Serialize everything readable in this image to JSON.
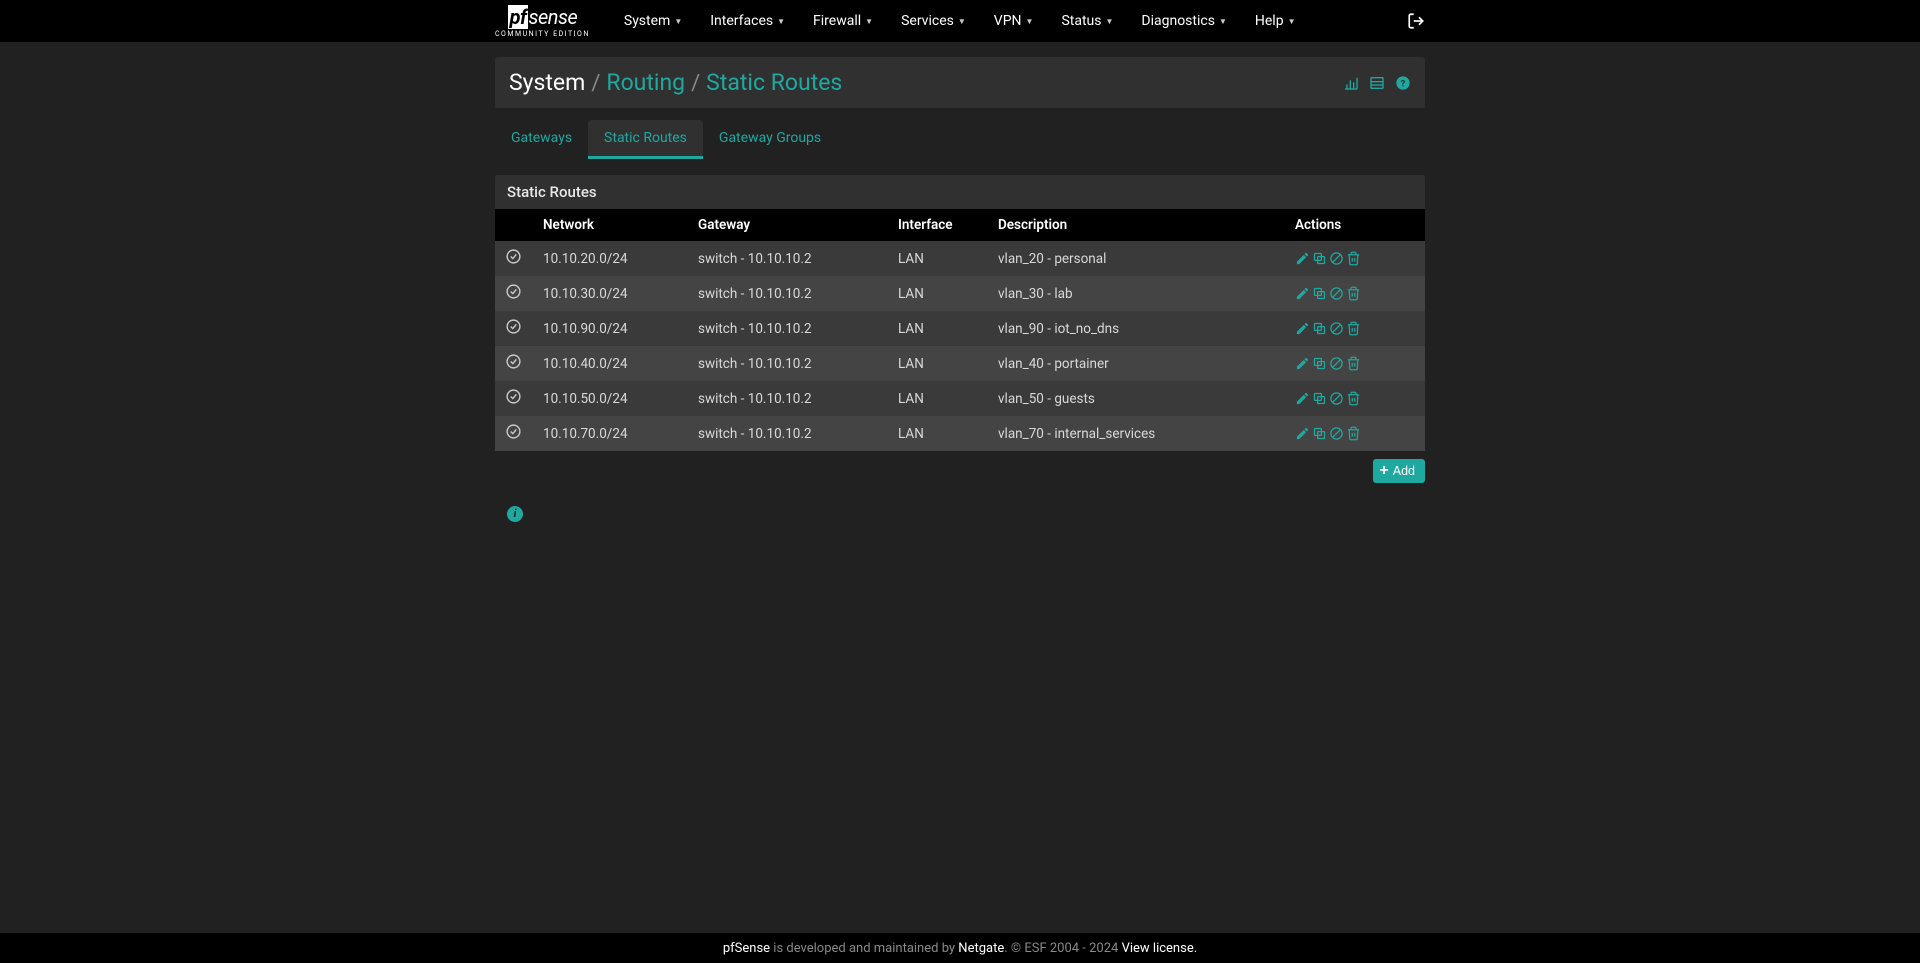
{
  "logo": {
    "prefix": "pf",
    "suffix": "sense",
    "subtitle": "COMMUNITY EDITION"
  },
  "nav": [
    {
      "label": "System"
    },
    {
      "label": "Interfaces"
    },
    {
      "label": "Firewall"
    },
    {
      "label": "Services"
    },
    {
      "label": "VPN"
    },
    {
      "label": "Status"
    },
    {
      "label": "Diagnostics"
    },
    {
      "label": "Help"
    }
  ],
  "breadcrumb": {
    "root": "System",
    "link1": "Routing",
    "current": "Static Routes"
  },
  "tabs": [
    {
      "label": "Gateways",
      "active": false
    },
    {
      "label": "Static Routes",
      "active": true
    },
    {
      "label": "Gateway Groups",
      "active": false
    }
  ],
  "panel": {
    "title": "Static Routes"
  },
  "table": {
    "headers": {
      "network": "Network",
      "gateway": "Gateway",
      "interface": "Interface",
      "description": "Description",
      "actions": "Actions"
    },
    "rows": [
      {
        "network": "10.10.20.0/24",
        "gateway": "switch - 10.10.10.2",
        "interface": "LAN",
        "description": "vlan_20 - personal"
      },
      {
        "network": "10.10.30.0/24",
        "gateway": "switch - 10.10.10.2",
        "interface": "LAN",
        "description": "vlan_30 - lab"
      },
      {
        "network": "10.10.90.0/24",
        "gateway": "switch - 10.10.10.2",
        "interface": "LAN",
        "description": "vlan_90 - iot_no_dns"
      },
      {
        "network": "10.10.40.0/24",
        "gateway": "switch - 10.10.10.2",
        "interface": "LAN",
        "description": "vlan_40 - portainer"
      },
      {
        "network": "10.10.50.0/24",
        "gateway": "switch - 10.10.10.2",
        "interface": "LAN",
        "description": "vlan_50 - guests"
      },
      {
        "network": "10.10.70.0/24",
        "gateway": "switch - 10.10.10.2",
        "interface": "LAN",
        "description": "vlan_70 - internal_services"
      }
    ]
  },
  "buttons": {
    "add": "Add"
  },
  "footer": {
    "product": "pfSense",
    "mid": " is developed and maintained by ",
    "company": "Netgate",
    "copyright": ". © ESF 2004 - 2024 ",
    "license": "View license."
  }
}
